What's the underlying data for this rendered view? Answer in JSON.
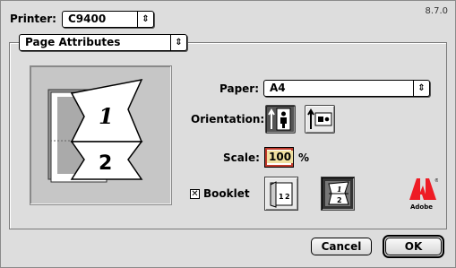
{
  "dialog": {
    "version": "8.7.0",
    "printer_label": "Printer:",
    "printer_value": "C9400",
    "panel_value": "Page Attributes"
  },
  "page_attributes": {
    "paper_label": "Paper:",
    "paper_value": "A4",
    "orientation_label": "Orientation:",
    "orientation_selected": "portrait",
    "scale_label": "Scale:",
    "scale_value": "100",
    "scale_unit": "%",
    "booklet_label": "Booklet",
    "booklet_checked": true,
    "booklet_checkmark": "✕"
  },
  "preview": {
    "page_numbers": [
      "1",
      "2"
    ]
  },
  "brand": {
    "name": "Adobe",
    "color": "#ee1c25"
  },
  "buttons": {
    "cancel_label": "Cancel",
    "ok_label": "OK"
  }
}
